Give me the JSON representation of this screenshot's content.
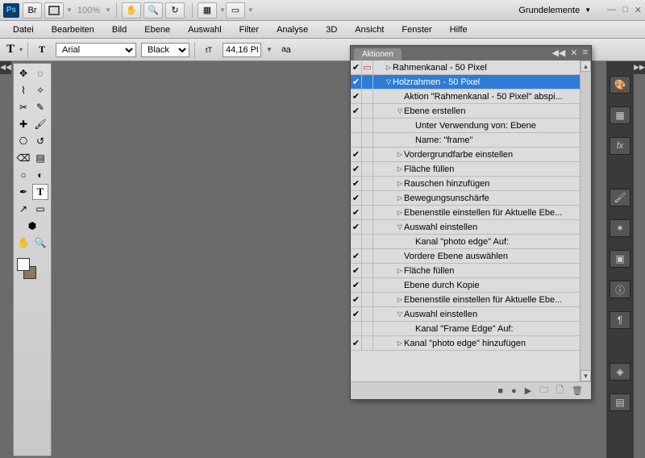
{
  "app_bar": {
    "zoom": "100%",
    "workspace": "Grundelemente"
  },
  "menu": [
    "Datei",
    "Bearbeiten",
    "Bild",
    "Ebene",
    "Auswahl",
    "Filter",
    "Analyse",
    "3D",
    "Ansicht",
    "Fenster",
    "Hilfe"
  ],
  "options": {
    "font": "Arial",
    "style": "Black",
    "size": "44,16 Pt"
  },
  "actions_panel": {
    "title": "Aktionen",
    "rows": [
      {
        "chk": true,
        "dlg": true,
        "indent": 1,
        "tri": "right",
        "text": "Rahmenkanal - 50 Pixel",
        "sel": false
      },
      {
        "chk": true,
        "dlg": false,
        "indent": 1,
        "tri": "down",
        "text": "Holzrahmen - 50 Pixel",
        "sel": true
      },
      {
        "chk": true,
        "dlg": false,
        "indent": 2,
        "tri": "",
        "text": "Aktion \"Rahmenkanal - 50 Pixel\" abspi...",
        "sel": false
      },
      {
        "chk": true,
        "dlg": false,
        "indent": 2,
        "tri": "down",
        "text": "Ebene erstellen",
        "sel": false
      },
      {
        "chk": false,
        "dlg": false,
        "indent": 3,
        "tri": "",
        "text": "Unter Verwendung von: Ebene",
        "sel": false
      },
      {
        "chk": false,
        "dlg": false,
        "indent": 3,
        "tri": "",
        "text": "Name:  \"frame\"",
        "sel": false
      },
      {
        "chk": true,
        "dlg": false,
        "indent": 2,
        "tri": "right",
        "text": "Vordergrundfarbe einstellen",
        "sel": false
      },
      {
        "chk": true,
        "dlg": false,
        "indent": 2,
        "tri": "right",
        "text": "Fläche füllen",
        "sel": false
      },
      {
        "chk": true,
        "dlg": false,
        "indent": 2,
        "tri": "right",
        "text": "Rauschen hinzufügen",
        "sel": false
      },
      {
        "chk": true,
        "dlg": false,
        "indent": 2,
        "tri": "right",
        "text": "Bewegungsunschärfe",
        "sel": false
      },
      {
        "chk": true,
        "dlg": false,
        "indent": 2,
        "tri": "right",
        "text": "Ebenenstile einstellen  für Aktuelle Ebe...",
        "sel": false
      },
      {
        "chk": true,
        "dlg": false,
        "indent": 2,
        "tri": "down",
        "text": "Auswahl einstellen",
        "sel": false
      },
      {
        "chk": false,
        "dlg": false,
        "indent": 3,
        "tri": "",
        "text": "Kanal \"photo edge\" Auf:",
        "sel": false
      },
      {
        "chk": true,
        "dlg": false,
        "indent": 2,
        "tri": "",
        "text": "Vordere Ebene auswählen",
        "sel": false
      },
      {
        "chk": true,
        "dlg": false,
        "indent": 2,
        "tri": "right",
        "text": "Fläche füllen",
        "sel": false
      },
      {
        "chk": true,
        "dlg": false,
        "indent": 2,
        "tri": "",
        "text": "Ebene durch Kopie",
        "sel": false
      },
      {
        "chk": true,
        "dlg": false,
        "indent": 2,
        "tri": "right",
        "text": "Ebenenstile einstellen  für Aktuelle Ebe...",
        "sel": false
      },
      {
        "chk": true,
        "dlg": false,
        "indent": 2,
        "tri": "down",
        "text": "Auswahl einstellen",
        "sel": false
      },
      {
        "chk": false,
        "dlg": false,
        "indent": 3,
        "tri": "",
        "text": "Kanal \"Frame Edge\" Auf:",
        "sel": false
      },
      {
        "chk": true,
        "dlg": false,
        "indent": 2,
        "tri": "right",
        "text": "Kanal \"photo edge\" hinzufügen",
        "sel": false
      }
    ]
  },
  "right_icons": [
    "palette",
    "swatches",
    "styles",
    "brush",
    "compass",
    "image",
    "info",
    "paragraph",
    "layers-a",
    "layers-b"
  ]
}
